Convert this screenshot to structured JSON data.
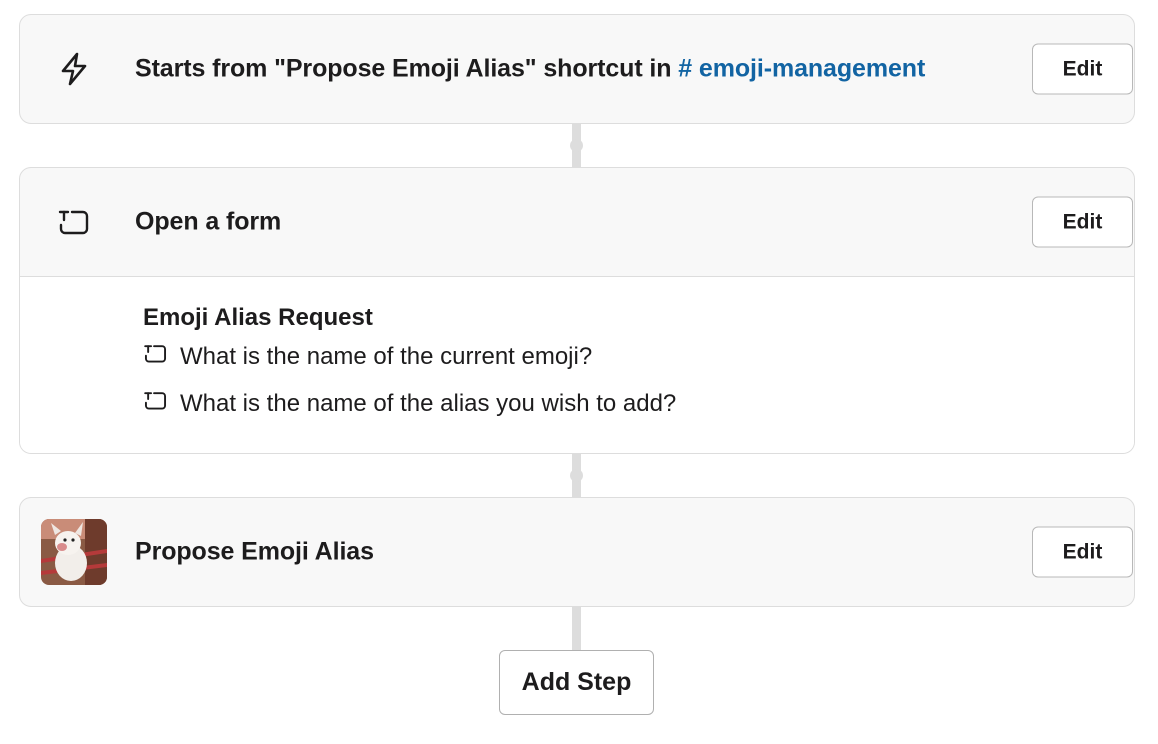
{
  "trigger": {
    "icon": "lightning-bolt-icon",
    "title_prefix": "Starts from \"Propose Emoji Alias\" shortcut in ",
    "channel": "# emoji-management",
    "edit_label": "Edit"
  },
  "form_step": {
    "icon": "form-icon",
    "title": "Open a form",
    "edit_label": "Edit",
    "form_name": "Emoji Alias Request",
    "questions": [
      {
        "icon": "text-field-icon",
        "text": "What is the name of the current emoji?"
      },
      {
        "icon": "text-field-icon",
        "text": "What is the name of the alias you wish to add?"
      }
    ]
  },
  "app_step": {
    "icon": "app-avatar",
    "title": "Propose Emoji Alias",
    "edit_label": "Edit"
  },
  "add_step_label": "Add Step",
  "colors": {
    "link": "#1264a3",
    "card_bg": "#f8f8f8",
    "border": "#dddddd",
    "connector": "#dddddd"
  }
}
